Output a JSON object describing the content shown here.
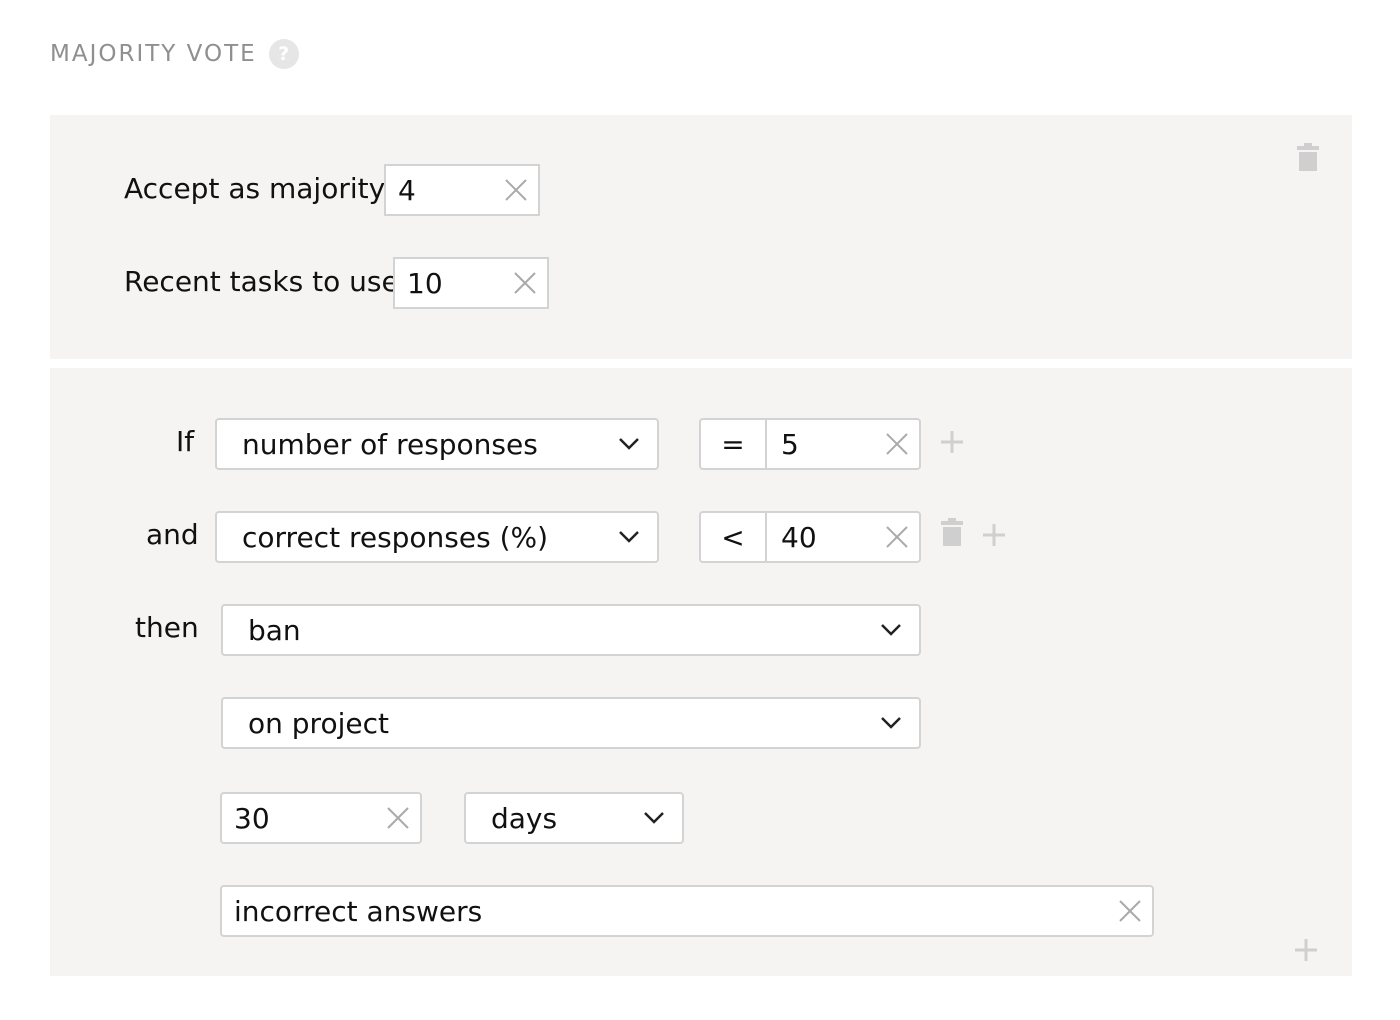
{
  "header": {
    "title": "MAJORITY VOTE",
    "help_icon": "?"
  },
  "settings": {
    "accept_majority": {
      "label": "Accept as majority",
      "value": "4"
    },
    "recent_tasks": {
      "label": "Recent tasks to use",
      "value": "10"
    }
  },
  "rule": {
    "conditions": [
      {
        "connector": "If",
        "field": "number of responses",
        "operator": "=",
        "value": "5"
      },
      {
        "connector": "and",
        "field": "correct responses (%)",
        "operator": "<",
        "value": "40"
      }
    ],
    "then_label": "then",
    "action": "ban",
    "scope": "on project",
    "duration": {
      "value": "30",
      "unit": "days"
    },
    "reason": "incorrect answers"
  },
  "icons": {
    "clear": "x-icon",
    "dropdown": "chevron-down-icon",
    "delete": "trash-icon",
    "add": "plus-icon",
    "help": "question-circle-icon"
  },
  "colors": {
    "panel_bg": "#f5f4f2",
    "border": "#d3d3d3",
    "muted_icon": "#cfcfcf",
    "title": "#8f8f8f"
  }
}
